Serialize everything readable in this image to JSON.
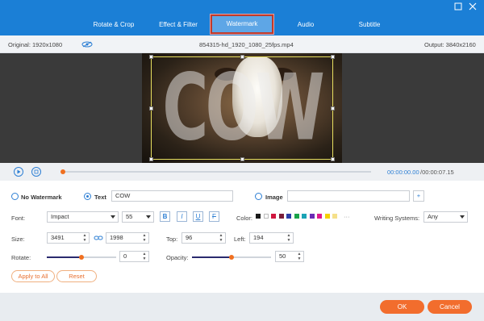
{
  "tabs": [
    {
      "label": "Rotate & Crop"
    },
    {
      "label": "Effect & Filter"
    },
    {
      "label": "Watermark"
    },
    {
      "label": "Audio"
    },
    {
      "label": "Subtitle"
    }
  ],
  "active_tab": "Watermark",
  "window": {
    "restore_icon": "restore-icon",
    "close_icon": "close-icon"
  },
  "info": {
    "original": "Original: 1920x1080",
    "filename": "854315-hd_1920_1080_25fps.mp4",
    "output": "Output: 3840x2160"
  },
  "preview": {
    "watermark_text": "COW"
  },
  "playback": {
    "current_time": "00:00:00.00",
    "total_time": "/00:00:07.15",
    "progress_fraction": 0.0
  },
  "watermark": {
    "no_watermark_label": "No Watermark",
    "text_label": "Text",
    "text_value": "COW",
    "image_label": "Image",
    "image_value": "",
    "add_symbol": "+"
  },
  "font": {
    "label": "Font:",
    "family": "Impact",
    "size": "55",
    "bold": "B",
    "italic": "I",
    "underline": "U",
    "strike": "F"
  },
  "color": {
    "label": "Color:",
    "swatches": [
      "#1a1a1a",
      "#ffffff",
      "#d0163f",
      "#7a1e3a",
      "#2b3ea8",
      "#1aa34a",
      "#1aa3b5",
      "#6b2bb5",
      "#e0198c",
      "#f5d000",
      "#f5e08a"
    ],
    "more": "···"
  },
  "writing": {
    "label": "Writing Systems:",
    "value": "Any"
  },
  "size": {
    "label": "Size:",
    "width": "3491",
    "height": "1998"
  },
  "position": {
    "top_label": "Top:",
    "top": "96",
    "left_label": "Left:",
    "left": "194"
  },
  "rotate": {
    "label": "Rotate:",
    "value": "0",
    "fraction": 0.5
  },
  "opacity": {
    "label": "Opacity:",
    "value": "50",
    "fraction": 0.5
  },
  "actions": {
    "apply_all": "Apply to All",
    "reset": "Reset"
  },
  "footer": {
    "ok": "OK",
    "cancel": "Cancel"
  }
}
